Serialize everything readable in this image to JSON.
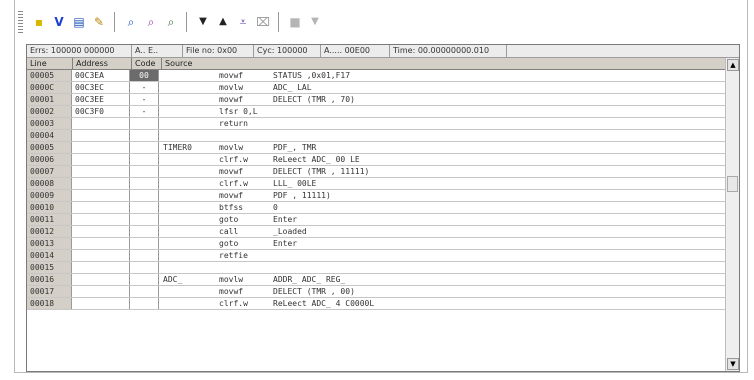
{
  "toolbar": {
    "buttons": [
      {
        "name": "grip-handle",
        "glyph": ""
      },
      {
        "name": "yellow-square-icon",
        "glyph": "▪"
      },
      {
        "name": "filter-icon",
        "glyph": "V"
      },
      {
        "name": "page-icon",
        "glyph": "▤"
      },
      {
        "name": "pencil-icon",
        "glyph": "✎"
      },
      {
        "name": "find-icon",
        "glyph": "⌕"
      },
      {
        "name": "find-next-icon",
        "glyph": "⌕"
      },
      {
        "name": "find-prev-icon",
        "glyph": "⌕"
      },
      {
        "name": "arrow-down-icon",
        "glyph": "▼"
      },
      {
        "name": "arrow-up-icon",
        "glyph": "▲"
      },
      {
        "name": "arrow-down-bar-icon",
        "glyph": "⩡"
      },
      {
        "name": "clear-icon",
        "glyph": "⌧"
      },
      {
        "name": "disabled-square-icon",
        "glyph": "■"
      },
      {
        "name": "disabled-arrow-icon",
        "glyph": "▼"
      }
    ]
  },
  "status": {
    "field1": "Errs: 100000  000000",
    "field2": "A..  E..",
    "field3": "File no: 0x00",
    "field4": "Cyc: 100000",
    "field5": "A..... 00E00",
    "field6": "Time: 00.00000000.010"
  },
  "columns": {
    "line": "Line",
    "addr": "Address",
    "code": "Code",
    "src": "Source"
  },
  "rows": [
    {
      "line": "00005",
      "addr": "00C3EA",
      "code": "00",
      "label": "",
      "op": "movwf",
      "args": "STATUS     ,0x01,F17",
      "sel": true
    },
    {
      "line": "0000C",
      "addr": "00C3EC",
      "code": "-",
      "label": "",
      "op": "movlw",
      "args": "ADC_  LAL",
      "sel": false
    },
    {
      "line": "00001",
      "addr": "00C3EE",
      "code": "-",
      "label": "",
      "op": "movwf",
      "args": "DELECT  (TMR  ,  70)",
      "sel": false
    },
    {
      "line": "00002",
      "addr": "00C3F0",
      "code": "-",
      "label": "",
      "op": "lfsr  0,L",
      "args": "",
      "sel": false
    },
    {
      "line": "00003",
      "addr": "",
      "code": "",
      "label": "",
      "op": "return",
      "args": "",
      "sel": false
    },
    {
      "line": "00004",
      "addr": "",
      "code": "",
      "label": "",
      "op": "",
      "args": "",
      "sel": false
    },
    {
      "line": "00005",
      "addr": "",
      "code": "",
      "label": "TIMER0",
      "op": "movlw",
      "args": "PDF_,  TMR",
      "sel": false
    },
    {
      "line": "00006",
      "addr": "",
      "code": "",
      "label": "",
      "op": "clrf.w",
      "args": "ReLeect  ADC_  00 LE",
      "sel": false
    },
    {
      "line": "00007",
      "addr": "",
      "code": "",
      "label": "",
      "op": "movwf",
      "args": "DELECT  (TMR  ,  11111)",
      "sel": false
    },
    {
      "line": "00008",
      "addr": "",
      "code": "",
      "label": "",
      "op": "clrf.w",
      "args": "LLL_  00LE",
      "sel": false
    },
    {
      "line": "00009",
      "addr": "",
      "code": "",
      "label": "",
      "op": "movwf",
      "args": "PDF  ,  11111)",
      "sel": false
    },
    {
      "line": "00010",
      "addr": "",
      "code": "",
      "label": "",
      "op": "btfss",
      "args": "0",
      "sel": false
    },
    {
      "line": "00011",
      "addr": "",
      "code": "",
      "label": "",
      "op": "goto",
      "args": "Enter",
      "sel": false
    },
    {
      "line": "00012",
      "addr": "",
      "code": "",
      "label": "",
      "op": "call",
      "args": "_Loaded",
      "sel": false
    },
    {
      "line": "00013",
      "addr": "",
      "code": "",
      "label": "",
      "op": "goto",
      "args": "Enter",
      "sel": false
    },
    {
      "line": "00014",
      "addr": "",
      "code": "",
      "label": "",
      "op": "retfie",
      "args": "",
      "sel": false
    },
    {
      "line": "00015",
      "addr": "",
      "code": "",
      "label": "",
      "op": "",
      "args": "",
      "sel": false
    },
    {
      "line": "00016",
      "addr": "",
      "code": "",
      "label": "ADC_",
      "op": "movlw",
      "args": "ADDR_  ADC_  REG_",
      "sel": false
    },
    {
      "line": "00017",
      "addr": "",
      "code": "",
      "label": "",
      "op": "movwf",
      "args": "DELECT  (TMR  ,  00)",
      "sel": false
    },
    {
      "line": "00018",
      "addr": "",
      "code": "",
      "label": "",
      "op": "clrf.w",
      "args": "ReLeect  ADC_  4 C0000L",
      "sel": false
    }
  ]
}
